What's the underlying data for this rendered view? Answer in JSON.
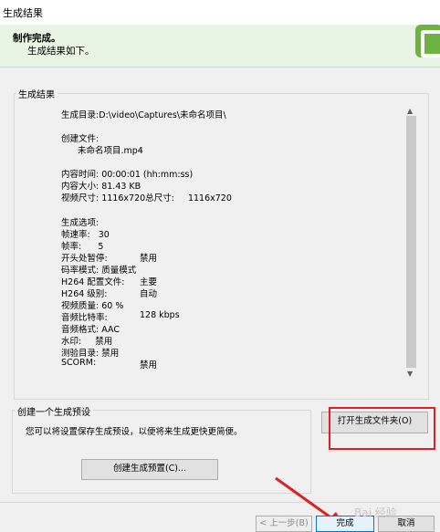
{
  "window": {
    "title": "生成结果"
  },
  "header": {
    "title": "制作完成。",
    "subtitle": "生成结果如下。"
  },
  "results": {
    "label": "生成结果",
    "lines": [
      "生成目录:D:\\video\\Captures\\未命名项目\\",
      "创建文件:",
      "未命名项目.mp4",
      "内容时间: 00:00:01 (hh:mm:ss)",
      "内容大小: 81.43 KB",
      "视频尺寸: 1116x720总尺寸:     1116x720",
      "生成选项:",
      "帧速率:   30",
      "帧率:      5",
      "开头处暂停:",
      "禁用",
      "码率模式: 质量模式",
      "H264 配置文件:",
      "主要",
      "H264 级别:",
      "自动",
      "视频质量: 60 %",
      "音频比特率:",
      "128 kbps",
      "音频格式: AAC",
      "水印:     禁用",
      "测验目录: 禁用",
      "SCORM:",
      "禁用"
    ]
  },
  "preset": {
    "label": "创建一个生成预设",
    "description": "您可以将设置保存生成预设，以便将来生成更快更简便。",
    "create_button": "创建生成预置(C)..."
  },
  "buttons": {
    "open_folder": "打开生成文件夹(O)",
    "back": "< 上一步(B)",
    "finish": "完成",
    "cancel": "取消"
  },
  "watermark": "Bai 经验",
  "colors": {
    "brand": "#6db33f",
    "header_bg": "#e9f5e4",
    "highlight": "#e02020"
  }
}
